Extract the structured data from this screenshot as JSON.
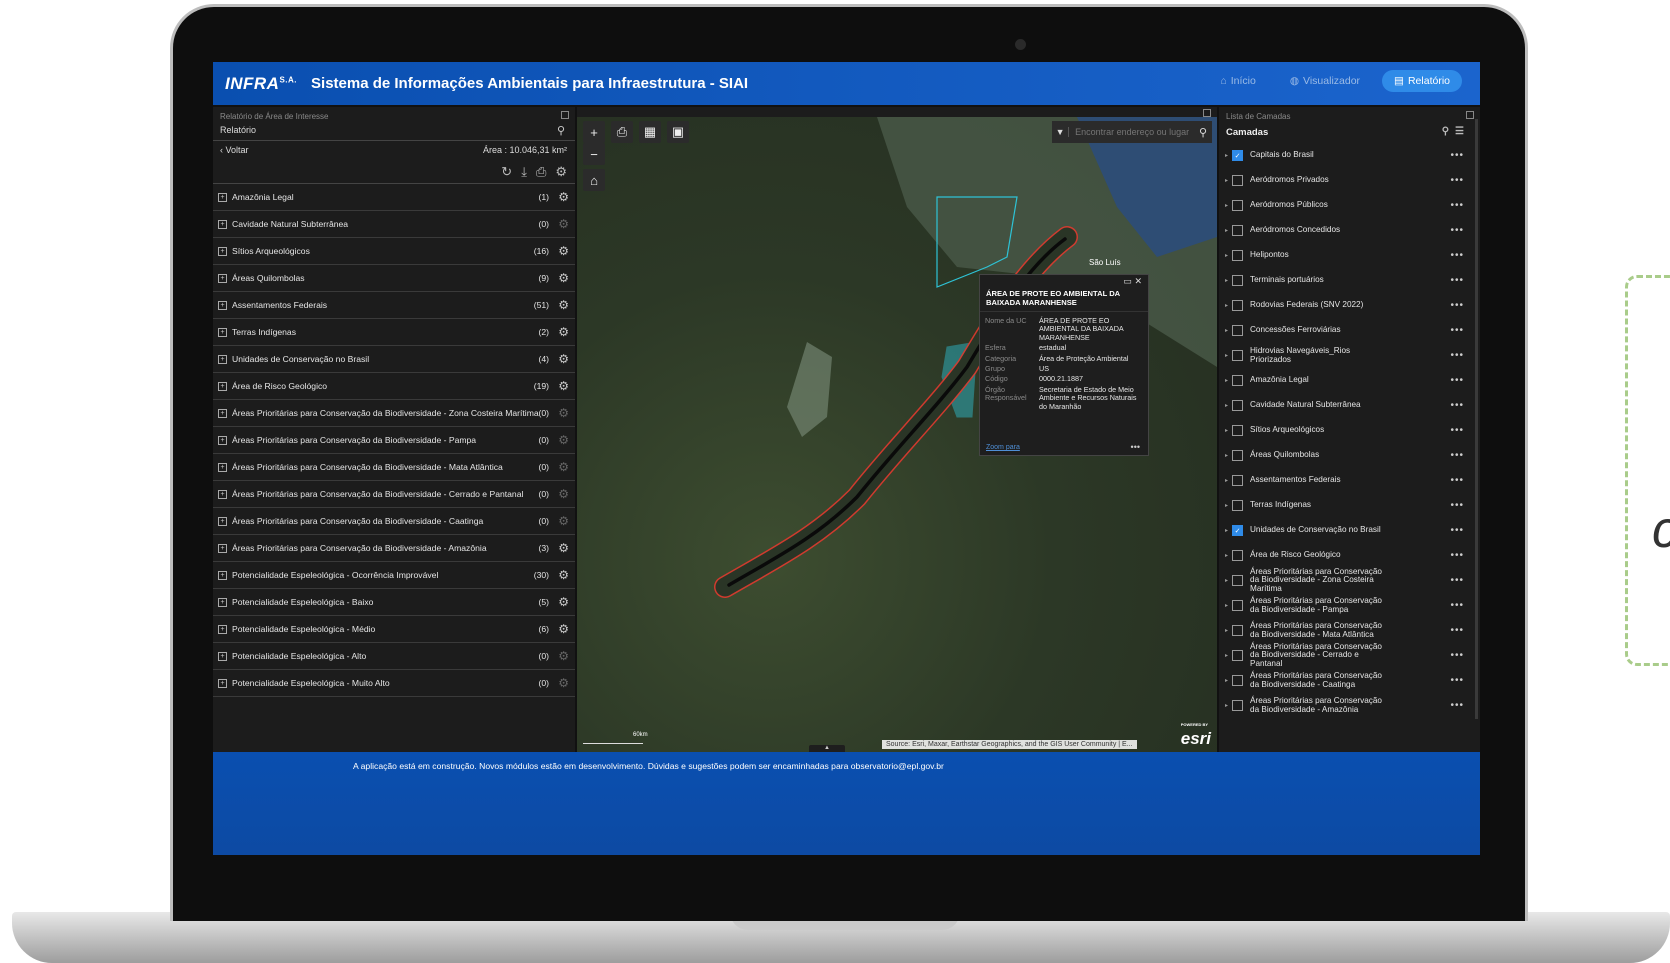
{
  "header": {
    "logo": "INFRA",
    "logo_suffix": "S.A.",
    "title": "Sistema de Informações Ambientais para Infraestrutura - SIAI",
    "nav": [
      {
        "label": "Início",
        "icon": "home-icon"
      },
      {
        "label": "Visualizador",
        "icon": "globe-icon"
      },
      {
        "label": "Relatório",
        "icon": "document-icon",
        "active": true
      }
    ]
  },
  "left_panel": {
    "caption": "Relatório de Área de Interesse",
    "tab": "Relatório",
    "back_label": "Voltar",
    "area_label": "Área : 10.046,31 km²",
    "layers": [
      {
        "label": "Amazônia Legal",
        "count": "(1)",
        "active": true
      },
      {
        "label": "Cavidade Natural Subterrânea",
        "count": "(0)",
        "active": false
      },
      {
        "label": "Sítios Arqueológicos",
        "count": "(16)",
        "active": true
      },
      {
        "label": "Áreas Quilombolas",
        "count": "(9)",
        "active": true
      },
      {
        "label": "Assentamentos Federais",
        "count": "(51)",
        "active": true
      },
      {
        "label": "Terras Indígenas",
        "count": "(2)",
        "active": true
      },
      {
        "label": "Unidades de Conservação no Brasil",
        "count": "(4)",
        "active": true
      },
      {
        "label": "Área de Risco Geológico",
        "count": "(19)",
        "active": true
      },
      {
        "label": "Áreas Prioritárias para Conservação da Biodiversidade - Zona Costeira Marítima",
        "count": "(0)",
        "active": false
      },
      {
        "label": "Áreas Prioritárias para Conservação da Biodiversidade - Pampa",
        "count": "(0)",
        "active": false
      },
      {
        "label": "Áreas Prioritárias para Conservação da Biodiversidade - Mata Atlântica",
        "count": "(0)",
        "active": false
      },
      {
        "label": "Áreas Prioritárias para Conservação da Biodiversidade - Cerrado e Pantanal",
        "count": "(0)",
        "active": false
      },
      {
        "label": "Áreas Prioritárias para Conservação da Biodiversidade - Caatinga",
        "count": "(0)",
        "active": false
      },
      {
        "label": "Áreas Prioritárias para Conservação da Biodiversidade - Amazônia",
        "count": "(3)",
        "active": true
      },
      {
        "label": "Potencialidade Espeleológica - Ocorrência Improvável",
        "count": "(30)",
        "active": true
      },
      {
        "label": "Potencialidade Espeleológica - Baixo",
        "count": "(5)",
        "active": true
      },
      {
        "label": "Potencialidade Espeleológica - Médio",
        "count": "(6)",
        "active": true
      },
      {
        "label": "Potencialidade Espeleológica - Alto",
        "count": "(0)",
        "active": false
      },
      {
        "label": "Potencialidade Espeleológica - Muito Alto",
        "count": "(0)",
        "active": false
      }
    ]
  },
  "map": {
    "search_placeholder": "Encontrar endereço ou lugar",
    "city_label": "São Luís",
    "scale_label": "60km",
    "attribution": "Source: Esri, Maxar, Earthstar Geographics, and the GIS User Community | E...",
    "esri_label": "esri",
    "esri_powered": "POWERED BY",
    "popup": {
      "title": "ÁREA DE PROTE EO AMBIENTAL DA BAIXADA MARANHENSE",
      "fields": [
        {
          "key": "Nome da UC",
          "value": "ÁREA DE PROTE EO AMBIENTAL DA BAIXADA MARANHENSE"
        },
        {
          "key": "Esfera",
          "value": "estadual"
        },
        {
          "key": "Categoria",
          "value": "Área de Proteção Ambiental"
        },
        {
          "key": "Grupo",
          "value": "US"
        },
        {
          "key": "Código",
          "value": "0000.21.1887"
        },
        {
          "key": "Órgão Responsável",
          "value": "Secretaria de Estado de Meio Ambiente e Recursos Naturais do Maranhão"
        }
      ],
      "zoom_label": "Zoom para"
    }
  },
  "right_panel": {
    "caption": "Lista de Camadas",
    "title": "Camadas",
    "layers": [
      {
        "label": "Capitais do Brasil",
        "checked": true
      },
      {
        "label": "Aeródromos Privados",
        "checked": false
      },
      {
        "label": "Aeródromos Públicos",
        "checked": false
      },
      {
        "label": "Aeródromos Concedidos",
        "checked": false
      },
      {
        "label": "Helipontos",
        "checked": false
      },
      {
        "label": "Terminais portuários",
        "checked": false
      },
      {
        "label": "Rodovias Federais (SNV 2022)",
        "checked": false
      },
      {
        "label": "Concessões Ferroviárias",
        "checked": false
      },
      {
        "label": "Hidrovias Navegáveis_Rios Priorizados",
        "checked": false
      },
      {
        "label": "Amazônia Legal",
        "checked": false
      },
      {
        "label": "Cavidade Natural Subterrânea",
        "checked": false
      },
      {
        "label": "Sítios Arqueológicos",
        "checked": false
      },
      {
        "label": "Áreas Quilombolas",
        "checked": false
      },
      {
        "label": "Assentamentos Federais",
        "checked": false
      },
      {
        "label": "Terras Indígenas",
        "checked": false
      },
      {
        "label": "Unidades de Conservação no Brasil",
        "checked": true
      },
      {
        "label": "Área de Risco Geológico",
        "checked": false
      },
      {
        "label": "Áreas Prioritárias para Conservação da Biodiversidade - Zona Costeira Marítima",
        "checked": false
      },
      {
        "label": "Áreas Prioritárias para Conservação da Biodiversidade - Pampa",
        "checked": false
      },
      {
        "label": "Áreas Prioritárias para Conservação da Biodiversidade - Mata Atlântica",
        "checked": false
      },
      {
        "label": "Áreas Prioritárias para Conservação da Biodiversidade - Cerrado e Pantanal",
        "checked": false
      },
      {
        "label": "Áreas Prioritárias para Conservação da Biodiversidade - Caatinga",
        "checked": false
      },
      {
        "label": "Áreas Prioritárias para Conservação da Biodiversidade - Amazônia",
        "checked": false
      }
    ]
  },
  "footer": {
    "message": "A aplicação está em construção. Novos módulos estão em desenvolvimento. Dúvidas e sugestões podem ser encaminhadas para observatorio@epl.gov.br"
  },
  "colors": {
    "brand_blue": "#0a4fb0",
    "accent_blue": "#2f8be8",
    "route_outline": "#e03a2f",
    "conservation_polygon": "#2ec3d6"
  }
}
